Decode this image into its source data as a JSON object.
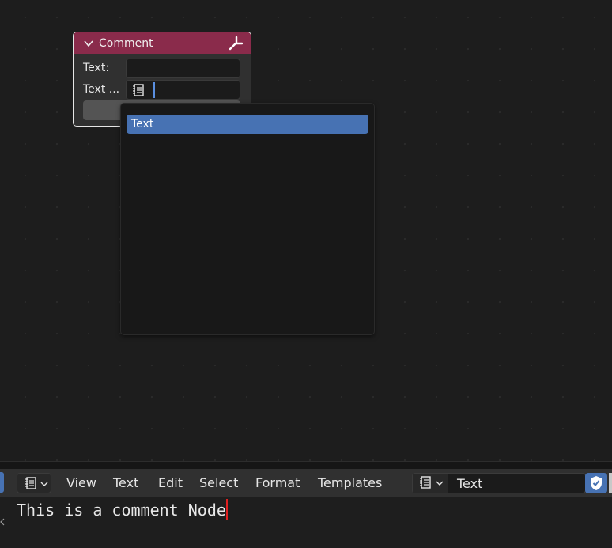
{
  "node_editor": {
    "node": {
      "title": "Comment",
      "pin_icon": "pin-icon",
      "collapse_icon": "chevron-down-icon",
      "row1_label": "Text:",
      "row2_label": "Text ...",
      "file_icon": "text-datablock-icon",
      "header_color": "#8a2b4b"
    },
    "dropdown": {
      "items": [
        "Text"
      ],
      "highlight_color": "#4772b3"
    }
  },
  "text_editor": {
    "editor_type_icon": "text-editor-icon",
    "menu": [
      "View",
      "Text",
      "Edit",
      "Select",
      "Format",
      "Templates"
    ],
    "datablock_name": "Text",
    "fake_user_icon": "shield-check-icon",
    "content": "This is a comment Node"
  }
}
